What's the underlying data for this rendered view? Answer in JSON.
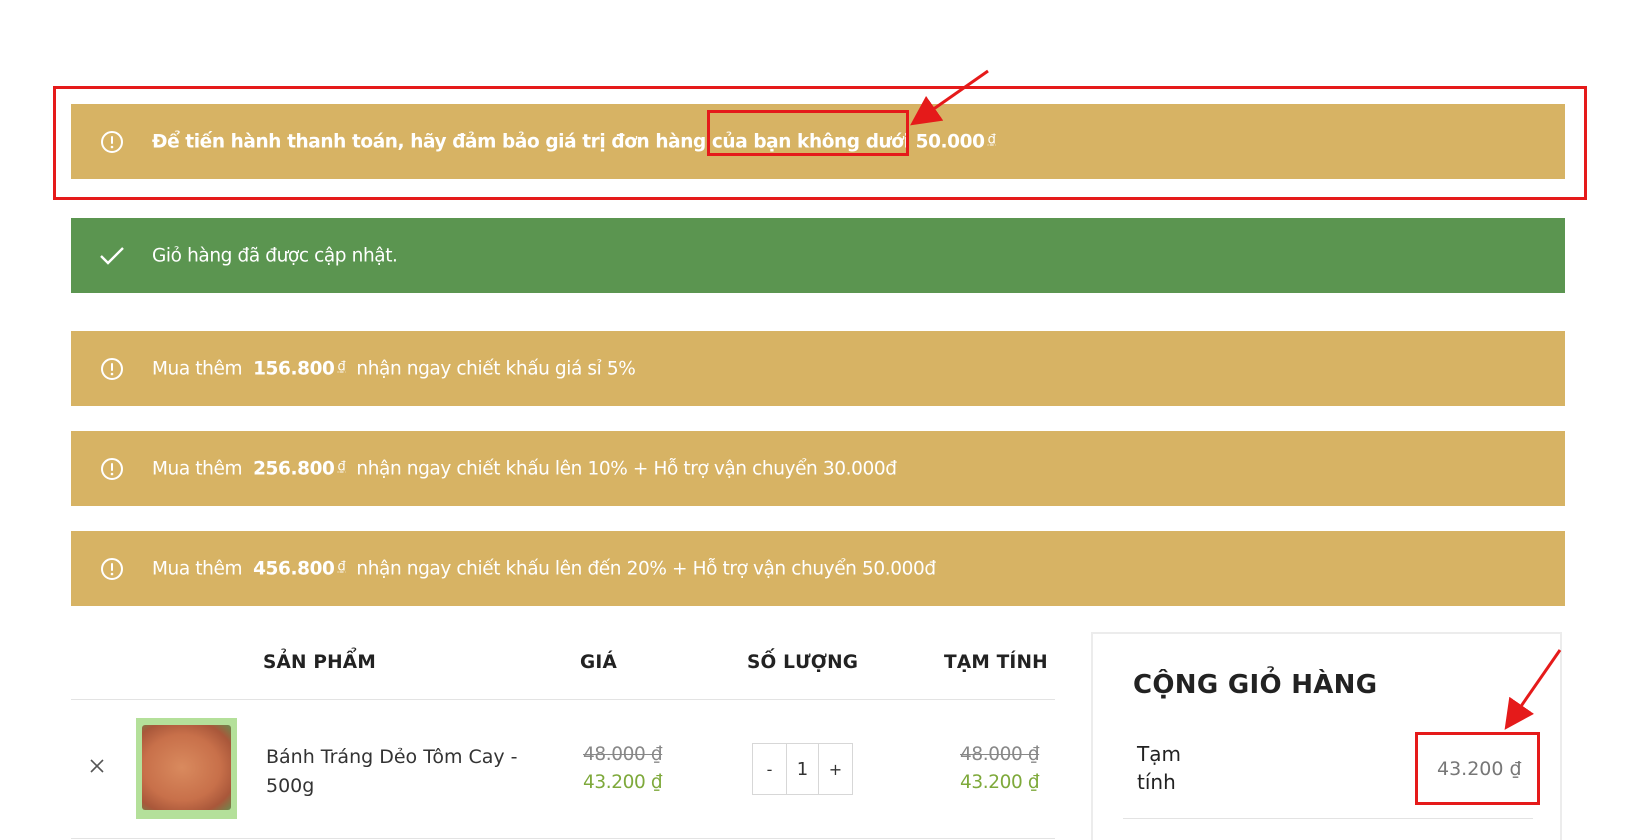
{
  "notices": {
    "min_order": {
      "text": "Để tiến hành thanh toán, hãy đảm bảo giá trị đơn hàng của bạn không dưới 50.000",
      "currency": "₫"
    },
    "updated": {
      "text": "Giỏ hàng đã được cập nhật."
    },
    "tier1": {
      "prefix": "Mua thêm",
      "amount": "156.800",
      "currency": "₫",
      "suffix": "nhận ngay chiết khấu giá sỉ 5%"
    },
    "tier2": {
      "prefix": "Mua thêm",
      "amount": "256.800",
      "currency": "₫",
      "suffix": "nhận ngay chiết khấu lên 10% + Hỗ trợ vận chuyển 30.000đ"
    },
    "tier3": {
      "prefix": "Mua thêm",
      "amount": "456.800",
      "currency": "₫",
      "suffix": "nhận ngay chiết khấu lên đến 20% + Hỗ trợ vận chuyển 50.000đ"
    }
  },
  "cart_table": {
    "headers": {
      "product": "SẢN PHẨM",
      "price": "GIÁ",
      "quantity": "SỐ LƯỢNG",
      "subtotal": "TẠM TÍNH"
    },
    "rows": [
      {
        "name": "Bánh Tráng Dẻo Tôm Cay - 500g",
        "price_old": "48.000 ₫",
        "price_new": "43.200 ₫",
        "quantity": "1",
        "qty_minus": "-",
        "qty_plus": "+",
        "subtotal_old": "48.000 ₫",
        "subtotal_new": "43.200 ₫"
      }
    ]
  },
  "cart_totals": {
    "title": "CỘNG GIỎ HÀNG",
    "subtotal_label": "Tạm tính",
    "subtotal_value": "43.200 ₫"
  },
  "colors": {
    "notice_gold": "#d7b364",
    "notice_green": "#5b9550",
    "annotation_red": "#e51a1a",
    "sale_price_green": "#7ea93b"
  },
  "icons": {
    "notice": "alert-circle-icon",
    "success": "check-icon",
    "remove": "close-icon"
  }
}
